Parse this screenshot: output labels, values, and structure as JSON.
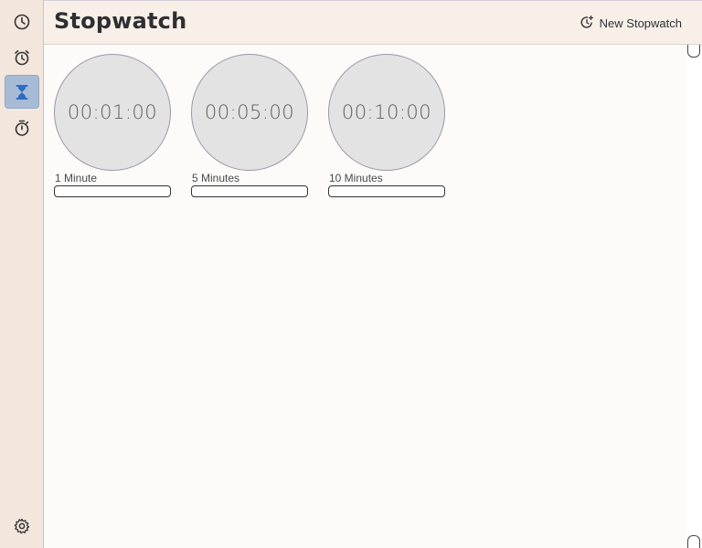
{
  "header": {
    "title": "Stopwatch",
    "new_button_label": "New Stopwatch",
    "new_button_icon": "timer-plus-icon"
  },
  "sidebar": {
    "items": [
      {
        "name": "world-clock",
        "icon": "clock-icon",
        "active": false
      },
      {
        "name": "alarm",
        "icon": "alarm-clock-icon",
        "active": false
      },
      {
        "name": "timer",
        "icon": "hourglass-icon",
        "active": true
      },
      {
        "name": "stopwatch",
        "icon": "stopwatch-icon",
        "active": false
      }
    ],
    "settings_icon": "gear-icon"
  },
  "timers": [
    {
      "time": "00:01:00",
      "label": "1 Minute",
      "input_value": ""
    },
    {
      "time": "00:05:00",
      "label": "5 Minutes",
      "input_value": ""
    },
    {
      "time": "00:10:00",
      "label": "10 Minutes",
      "input_value": ""
    }
  ],
  "colors": {
    "sidebar_bg": "#f3e6dd",
    "header_bg": "#f8efe9",
    "active_nav": "#a8bbd6",
    "dial_bg": "#e3e3e3",
    "accent": "#2b6cc4"
  }
}
